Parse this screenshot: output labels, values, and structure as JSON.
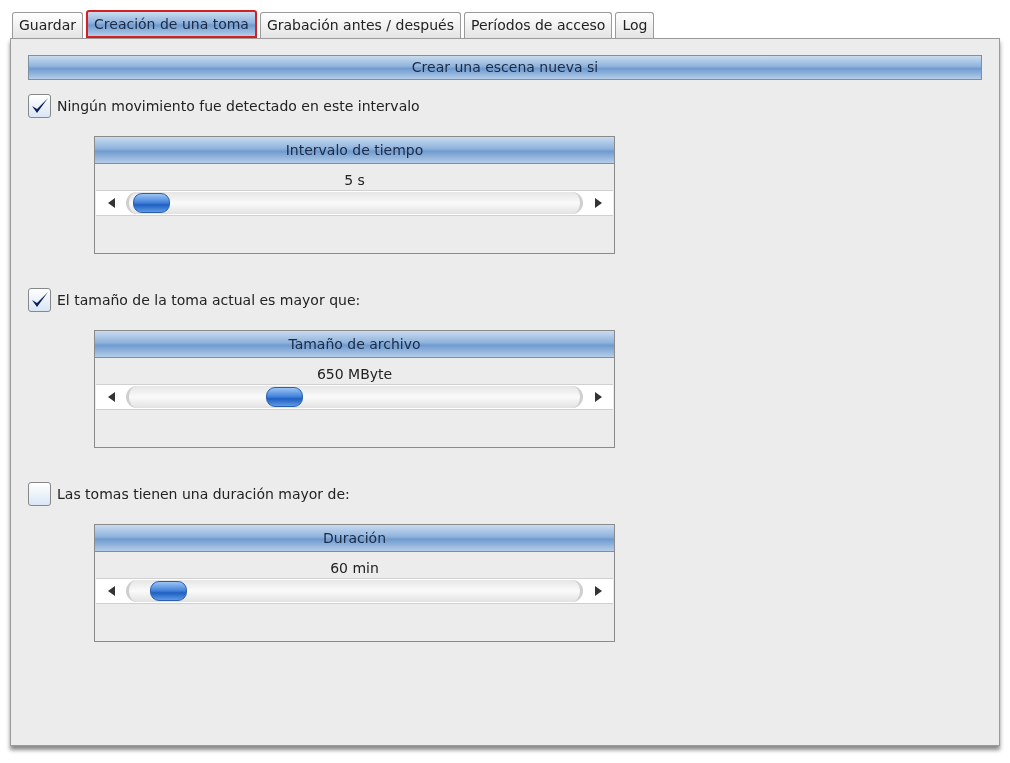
{
  "tabs": [
    {
      "label": "Guardar",
      "selected": false
    },
    {
      "label": "Creación de una toma",
      "selected": true
    },
    {
      "label": "Grabación antes / después",
      "selected": false
    },
    {
      "label": "Períodos de acceso",
      "selected": false
    },
    {
      "label": "Log",
      "selected": false
    }
  ],
  "section_title": "Crear una escena nueva si",
  "conditions": [
    {
      "label": "Ningún movimiento fue detectado en este intervalo",
      "checked": true,
      "slider": {
        "title": "Intervalo de tiempo",
        "reading": "5 s",
        "level": 0.01
      }
    },
    {
      "label": "El tamaño de la toma actual es mayor que:",
      "checked": true,
      "slider": {
        "title": "Tamaño de archivo",
        "reading": "650 MByte",
        "level": 0.33
      }
    },
    {
      "label": "Las tomas tienen una duración mayor de:",
      "checked": false,
      "slider": {
        "title": "Duración",
        "reading": "60 min",
        "level": 0.05
      }
    }
  ]
}
